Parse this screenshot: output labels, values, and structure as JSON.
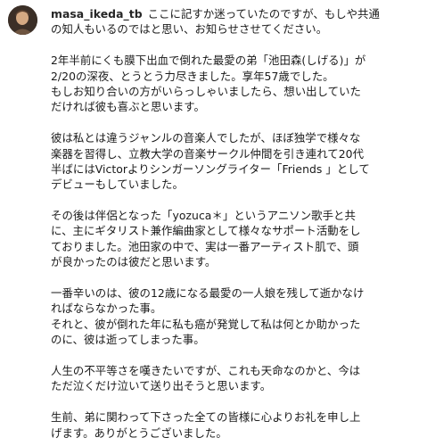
{
  "post": {
    "username": "masa_ikeda_tb",
    "caption_lines": [
      "ここに記すか迷っていたのですが、もしや共通",
      "の知人もいるのではと思い、お知らせさせてください。",
      "",
      "2年半前にくも膜下出血で倒れた最愛の弟「池田森(しげる)」が",
      "2/20の深夜、とうとう力尽きました。享年57歳でした。",
      "もしお知り合いの方がいらっしゃいましたら、想い出していた",
      "だければ彼も喜ぶと思います。",
      "",
      "彼は私とは違うジャンルの音楽人でしたが、ほぼ独学で様々な",
      "楽器を習得し、立教大学の音楽サークル仲間を引き連れて20代",
      "半ばにはVictorよりシンガーソングライター「Friends 」として",
      "デビューもしていました。",
      "",
      "その後は伴侶となった「yozuca＊」というアニソン歌手と共",
      "に、主にギタリスト兼作編曲家として様々なサポート活動をし",
      "ておりました。池田家の中で、実は一番アーティスト肌で、頭",
      "が良かったのは彼だと思います。",
      "",
      "一番辛いのは、彼の12歳になる最愛の一人娘を残して逝かなけ",
      "ればならなかった事。",
      "それと、彼が倒れた年に私も癌が発覚して私は何とか助かった",
      "のに、彼は逝ってしまった事。",
      "",
      "人生の不平等さを嘆きたいですが、これも天命なのかと、今は",
      "ただ泣くだけ泣いて送り出そうと思います。",
      "",
      "生前、弟に関わって下さった全ての皆様に心よりお礼を申し上",
      "げます。ありがとうございました。"
    ]
  }
}
